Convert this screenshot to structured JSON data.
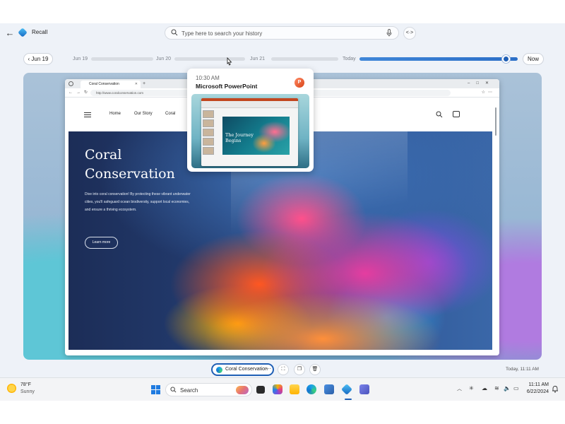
{
  "app": {
    "title": "Recall"
  },
  "search": {
    "placeholder": "Type here to search your history"
  },
  "timeline": {
    "back_label": "Jun 19",
    "labels": [
      "Jun 19",
      "Jun 20",
      "Jun 21",
      "Today"
    ],
    "now_label": "Now",
    "position_fraction": 0.93
  },
  "tooltip": {
    "time": "10:30 AM",
    "app": "Microsoft PowerPoint",
    "slide_title": "The Journey Begins"
  },
  "browser": {
    "tab_title": "Coral Conservation",
    "url": "http://www.coralconservation.com"
  },
  "site": {
    "nav": [
      "Home",
      "Our Story",
      "Coral"
    ],
    "hero_title_line1": "Coral",
    "hero_title_line2": "Conservation",
    "hero_desc": "Dive into coral conservation! By protecting these vibrant underwater cities, you'll safeguard ocean biodiversity, support local economies, and ensure a thriving ecosystem.",
    "hero_button": "Learn more"
  },
  "snapshot_bar": {
    "chip_label": "Coral Conservation",
    "chip_more": "···",
    "timestamp": "Today, 11:11 AM"
  },
  "taskbar": {
    "weather_temp": "78°F",
    "weather_cond": "Sunny",
    "search_label": "Search",
    "time": "11:11 AM",
    "date": "6/22/2024"
  },
  "colors": {
    "accent": "#1f5fb5",
    "timeline_fill": "#3f86d8"
  }
}
